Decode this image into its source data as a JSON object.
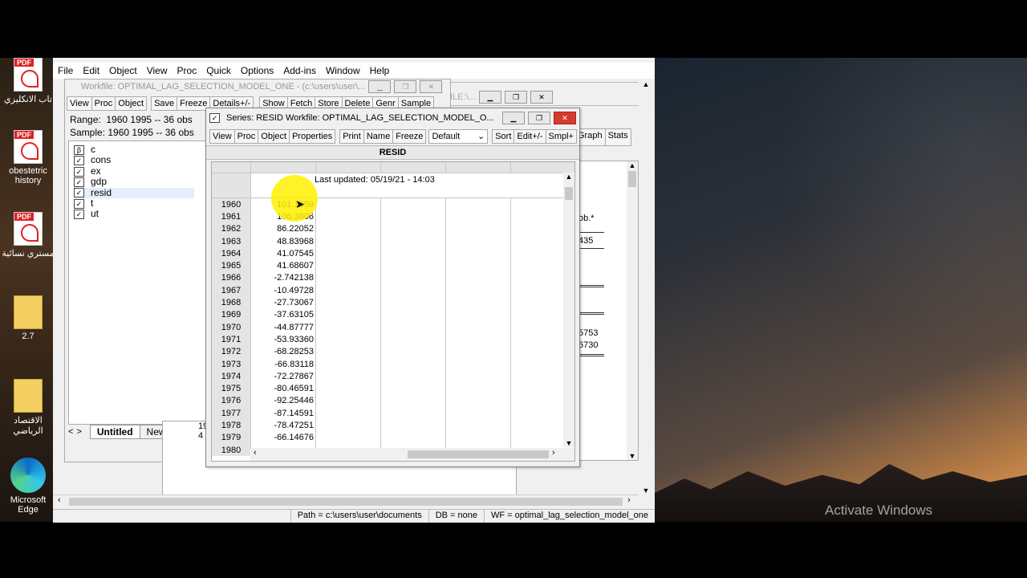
{
  "desktop": {
    "icons": [
      {
        "label": "تاب الانكليزي",
        "icon": "pdf-icon"
      },
      {
        "label": "obestetric history",
        "icon": "pdf-icon"
      },
      {
        "label": "مستري نسائية",
        "icon": "pdf-icon"
      },
      {
        "label": "2.7",
        "icon": "folder-icon"
      },
      {
        "label": "الاقتصاد الرياضي",
        "icon": "pdf-icon"
      },
      {
        "label": "Microsoft Edge",
        "icon": "edge-icon"
      }
    ],
    "watermark": "Activate Windows"
  },
  "menu": [
    "File",
    "Edit",
    "Object",
    "View",
    "Proc",
    "Quick",
    "Options",
    "Add-ins",
    "Window",
    "Help"
  ],
  "workfile": {
    "title": "Workfile: OPTIMAL_LAG_SELECTION_MODEL_ONE - (c:\\users\\user\\...",
    "toolbar": [
      "View",
      "Proc",
      "Object",
      "Save",
      "Freeze",
      "Details+/-",
      "Show",
      "Fetch",
      "Store",
      "Delete",
      "Genr",
      "Sample"
    ],
    "range_label": "Range:",
    "range_value": "1960 1995  --  36 obs",
    "sample_label": "Sample:",
    "sample_value": "1960 1995  --  36 obs",
    "objects": [
      {
        "name": "c",
        "type": "coef"
      },
      {
        "name": "cons",
        "type": "series"
      },
      {
        "name": "ex",
        "type": "series"
      },
      {
        "name": "gdp",
        "type": "series"
      },
      {
        "name": "resid",
        "type": "series"
      },
      {
        "name": "t",
        "type": "series"
      },
      {
        "name": "ut",
        "type": "series"
      }
    ],
    "tabs": [
      "Untitled",
      "New Page"
    ],
    "bg_window_fragment": "ILE:\\..."
  },
  "behind": {
    "text1": "ob.*",
    "text2": "435",
    "text3": "5753",
    "text4": "6730",
    "toolbar": [
      "Graph",
      "Stats"
    ],
    "small1": "19",
    "small2": "4"
  },
  "series": {
    "title": "Series: RESID   Workfile: OPTIMAL_LAG_SELECTION_MODEL_O...",
    "toolbar": [
      "View",
      "Proc",
      "Object",
      "Properties",
      "Print",
      "Name",
      "Freeze"
    ],
    "display_select": "Default",
    "toolbar2": [
      "Sort",
      "Edit+/-",
      "Smpl+"
    ],
    "column_header": "RESID",
    "last_updated": "Last updated: 05/19/21 - 14:03",
    "rows": [
      {
        "year": "1960",
        "value": "101.1559"
      },
      {
        "year": "1961",
        "value": "106.3806"
      },
      {
        "year": "1962",
        "value": "86.22052"
      },
      {
        "year": "1963",
        "value": "48.83968"
      },
      {
        "year": "1964",
        "value": "41.07545"
      },
      {
        "year": "1965",
        "value": "41.68607"
      },
      {
        "year": "1966",
        "value": "-2.742138"
      },
      {
        "year": "1967",
        "value": "-10.49728"
      },
      {
        "year": "1968",
        "value": "-27.73067"
      },
      {
        "year": "1969",
        "value": "-37.63105"
      },
      {
        "year": "1970",
        "value": "-44.87777"
      },
      {
        "year": "1971",
        "value": "-53.93360"
      },
      {
        "year": "1972",
        "value": "-68.28253"
      },
      {
        "year": "1973",
        "value": "-66.83118"
      },
      {
        "year": "1974",
        "value": "-72.27867"
      },
      {
        "year": "1975",
        "value": "-80.46591"
      },
      {
        "year": "1976",
        "value": "-92.25446"
      },
      {
        "year": "1977",
        "value": "-87.14591"
      },
      {
        "year": "1978",
        "value": "-78.47251"
      },
      {
        "year": "1979",
        "value": "-66.14676"
      },
      {
        "year": "1980",
        "value": ""
      }
    ]
  },
  "statusbar": {
    "path": "Path = c:\\users\\user\\documents",
    "db": "DB = none",
    "wf": "WF = optimal_lag_selection_model_one"
  }
}
